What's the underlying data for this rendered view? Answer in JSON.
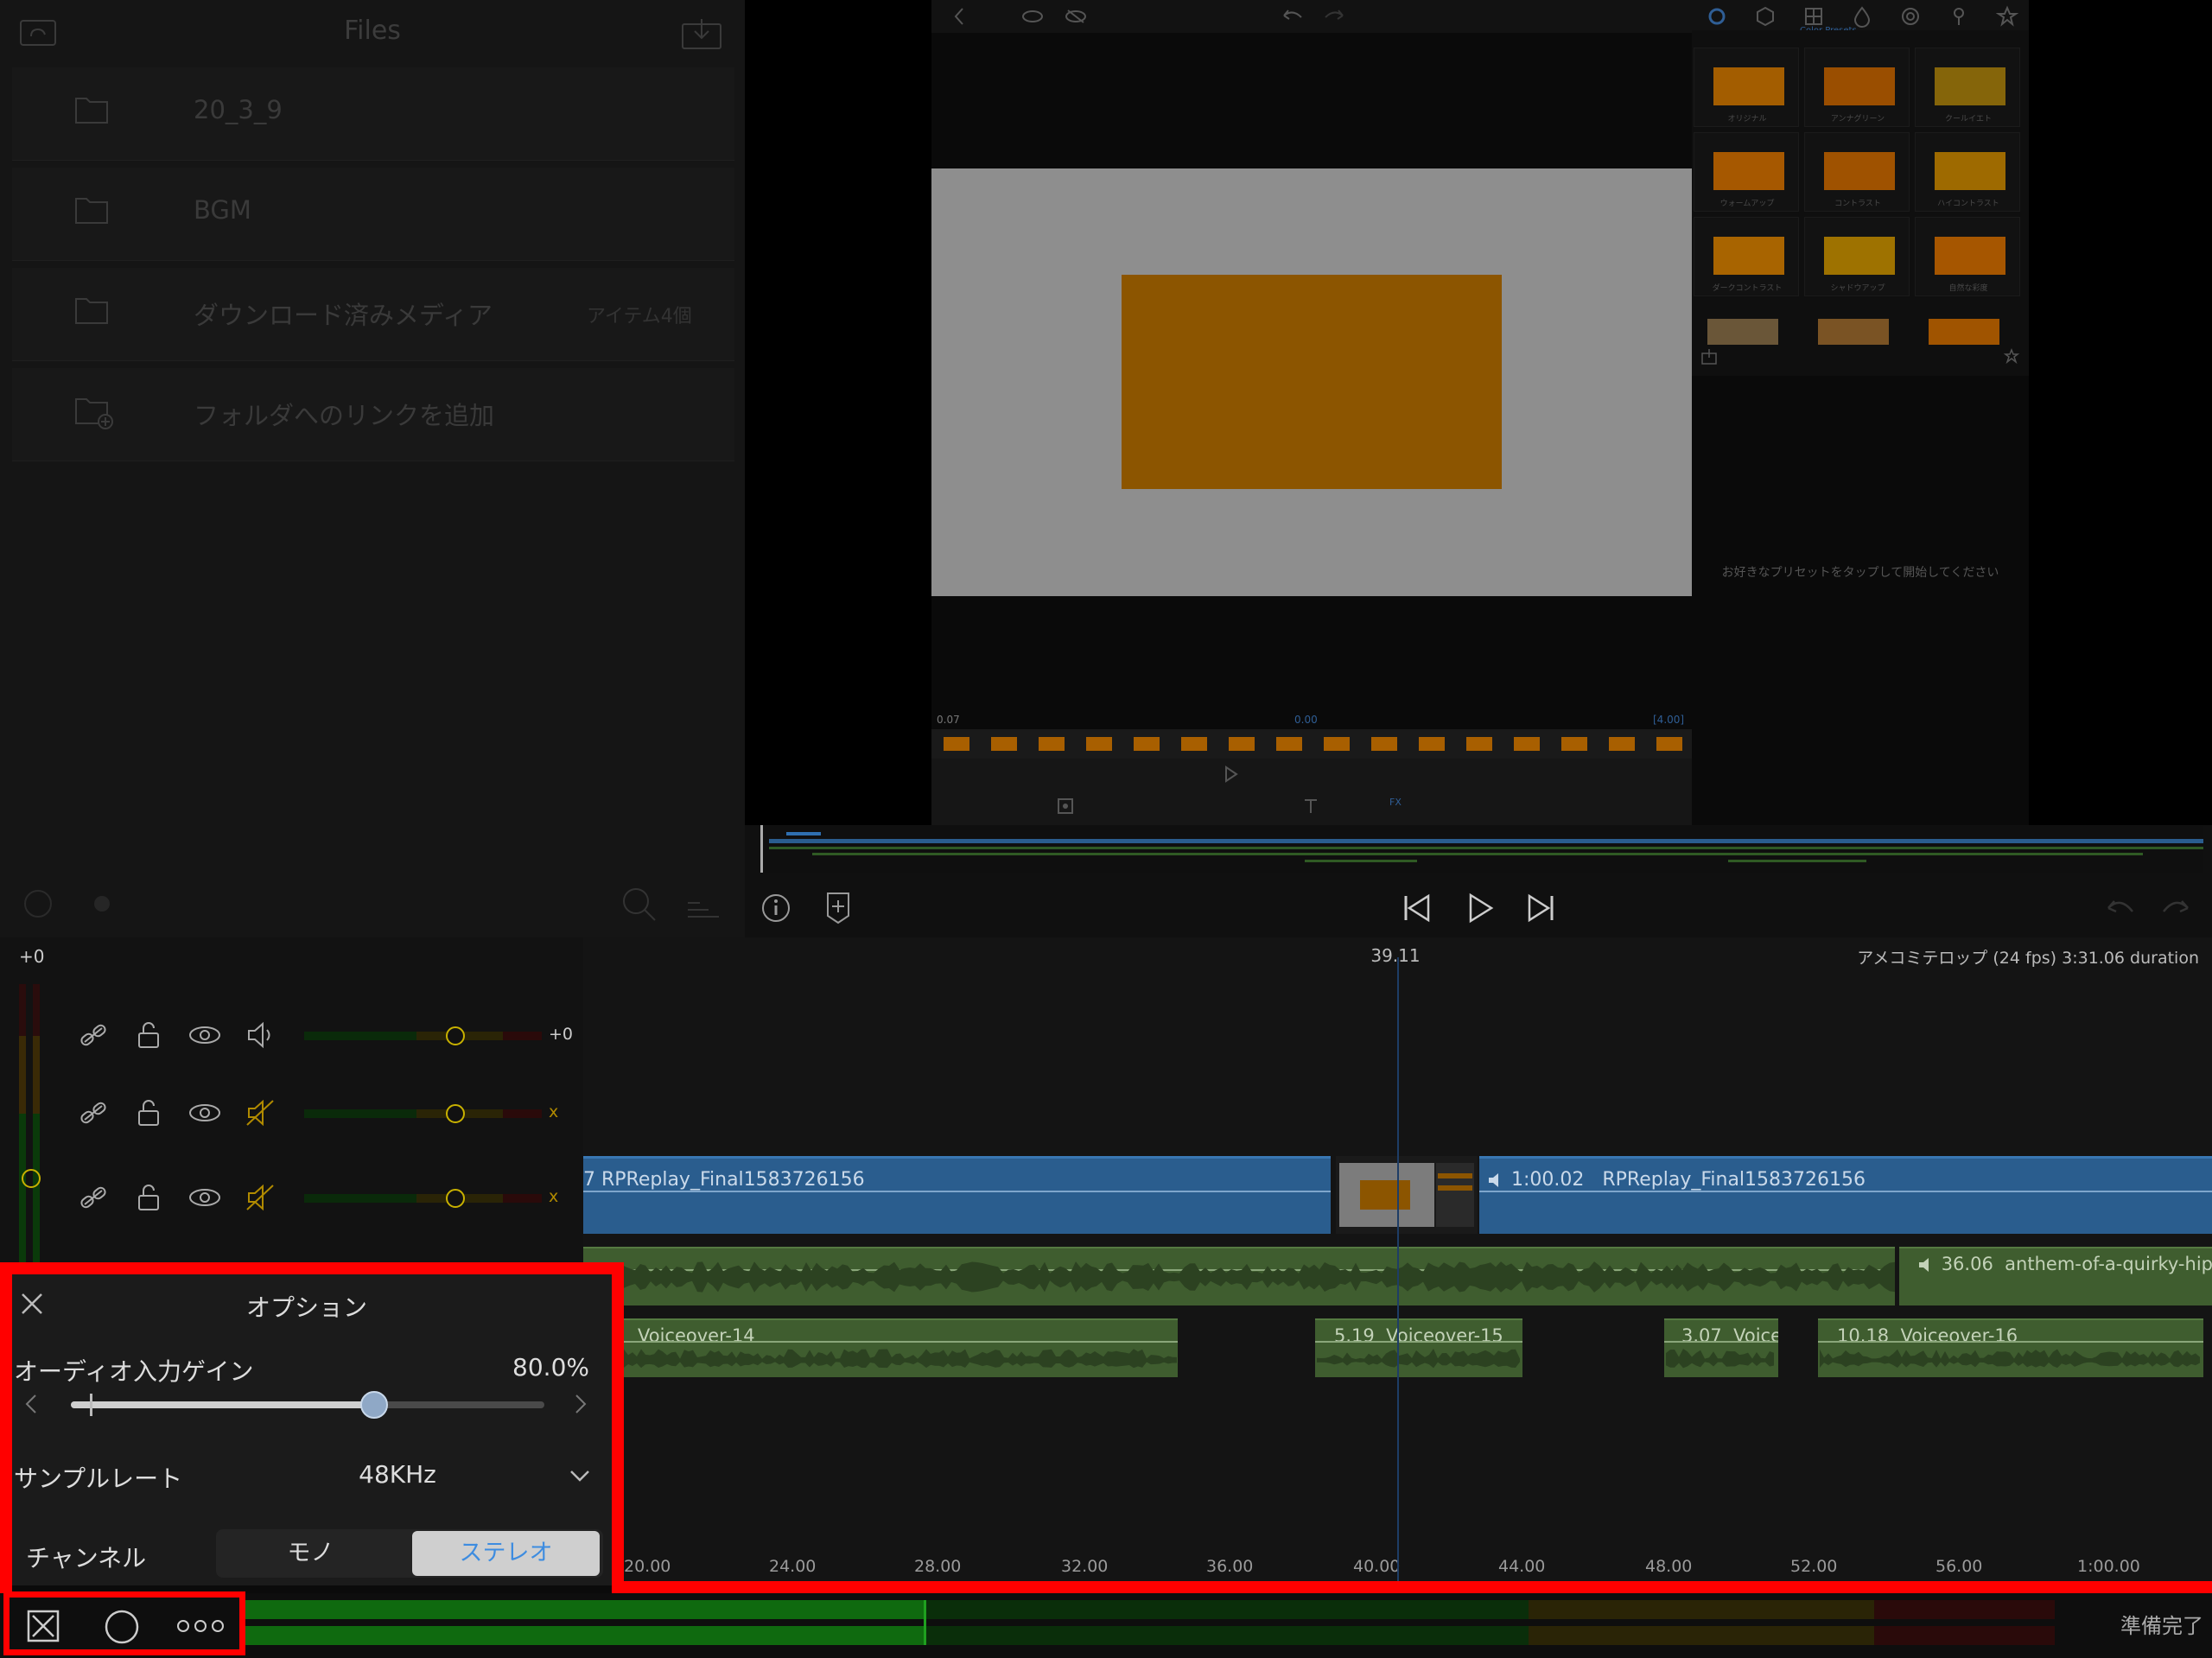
{
  "files": {
    "title": "Files",
    "rows": [
      {
        "name": "20_3_9",
        "meta": ""
      },
      {
        "name": "BGM",
        "meta": ""
      },
      {
        "name": "ダウンロード済みメディア",
        "meta": "アイテム4個"
      },
      {
        "name": "フォルダへのリンクを追加",
        "meta": ""
      }
    ]
  },
  "viewer": {
    "timecode_left": "0.07",
    "timecode_center": "0.00",
    "timecode_right": "[4.00]",
    "presets_title": "Color Presets",
    "presets": [
      "オリジナル",
      "アンナグリーン",
      "クールイエト",
      "ウォームアップ",
      "コントラスト",
      "ハイコントラスト",
      "ダークコントラスト",
      "シャドウアップ",
      "自然な彩度"
    ],
    "hint": "お好きなプリセットをタップして開始してください",
    "fx_label": "FX"
  },
  "timeline": {
    "playhead_time": "39.11",
    "project_info": "アメコミテロップ (24 fps) 3:31.06 duration",
    "level_label": "+0",
    "track_values": [
      "+0",
      "x",
      "x"
    ],
    "clips": {
      "video_a": "7  RPReplay_Final1583726156",
      "video_b_dur": "1:00.02",
      "video_b": "RPReplay_Final1583726156",
      "bgm_dur": "36.06",
      "bgm": "anthem-of-a-quirky-hip",
      "vo14": "Voiceover-14",
      "vo15_dur": "5.19",
      "vo15": "Voiceover-15",
      "vo_small_dur": "3.07",
      "vo_small": "Voice",
      "vo16_dur": "10.18",
      "vo16": "Voiceover-16"
    },
    "ruler": [
      "20.00",
      "24.00",
      "28.00",
      "32.00",
      "36.00",
      "40.00",
      "44.00",
      "48.00",
      "52.00",
      "56.00",
      "1:00.00"
    ]
  },
  "options": {
    "title": "オプション",
    "gain_label": "オーディオ入力ゲイン",
    "gain_value": "80.0%",
    "gain_level": 0.8,
    "sample_rate_label": "サンプルレート",
    "sample_rate_value": "48KHz",
    "channel_label": "チャンネル",
    "channel_mono": "モノ",
    "channel_stereo": "ステレオ",
    "channel_selected": "ステレオ"
  },
  "status": {
    "text": "準備完了"
  },
  "colors": {
    "highlight": "#ff0000",
    "video_clip": "#2a5d8e",
    "audio_clip": "#3f5d2f",
    "meter_green": "#0f6a0f",
    "selected_segment": "#cfcfcf"
  }
}
